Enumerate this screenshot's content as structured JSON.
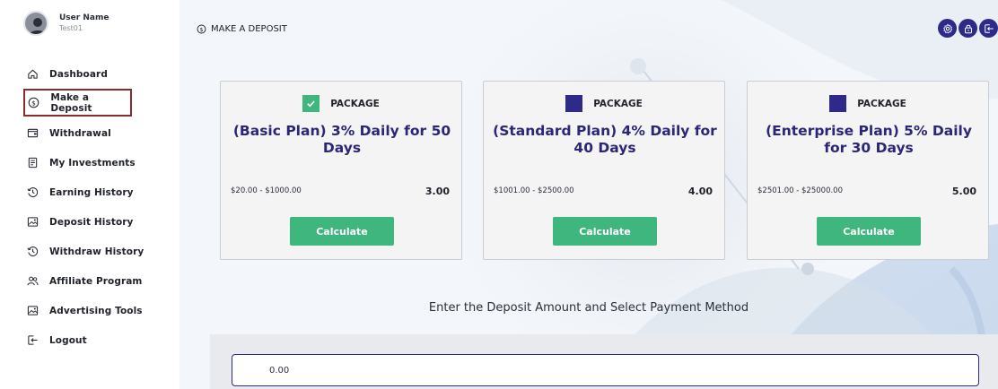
{
  "user": {
    "name": "User Name",
    "id": "Test01"
  },
  "nav": {
    "items": [
      {
        "label": "Dashboard",
        "icon": "home-icon"
      },
      {
        "label": "Make a Deposit",
        "icon": "dollar-circle-icon",
        "active": true
      },
      {
        "label": "Withdrawal",
        "icon": "wallet-icon"
      },
      {
        "label": "My Investments",
        "icon": "document-icon"
      },
      {
        "label": "Earning History",
        "icon": "history-icon"
      },
      {
        "label": "Deposit History",
        "icon": "image-icon"
      },
      {
        "label": "Withdraw History",
        "icon": "history-icon"
      },
      {
        "label": "Affiliate Program",
        "icon": "users-icon"
      },
      {
        "label": "Advertising Tools",
        "icon": "image-icon"
      },
      {
        "label": "Logout",
        "icon": "logout-icon"
      }
    ]
  },
  "header": {
    "title": "MAKE A DEPOSIT",
    "actions": [
      "settings-icon",
      "lock-icon",
      "logout-icon"
    ]
  },
  "packages": [
    {
      "badge": "PACKAGE",
      "selected": true,
      "plan": "(Basic Plan) 3% Daily for 50 Days",
      "range": "$20.00 - $1000.00",
      "rate": "3.00",
      "button": "Calculate"
    },
    {
      "badge": "PACKAGE",
      "selected": false,
      "plan": "(Standard Plan) 4% Daily for 40 Days",
      "range": "$1001.00 - $2500.00",
      "rate": "4.00",
      "button": "Calculate"
    },
    {
      "badge": "PACKAGE",
      "selected": false,
      "plan": "(Enterprise Plan) 5% Daily for 30 Days",
      "range": "$2501.00 - $25000.00",
      "rate": "5.00",
      "button": "Calculate"
    }
  ],
  "deposit": {
    "heading": "Enter the Deposit Amount and Select Payment Method",
    "amount_value": "0.00"
  },
  "colors": {
    "accent": "#2e2a8a",
    "success": "#3eb67d",
    "active_border": "#8b2a2f",
    "frame": "#0f1a35"
  }
}
